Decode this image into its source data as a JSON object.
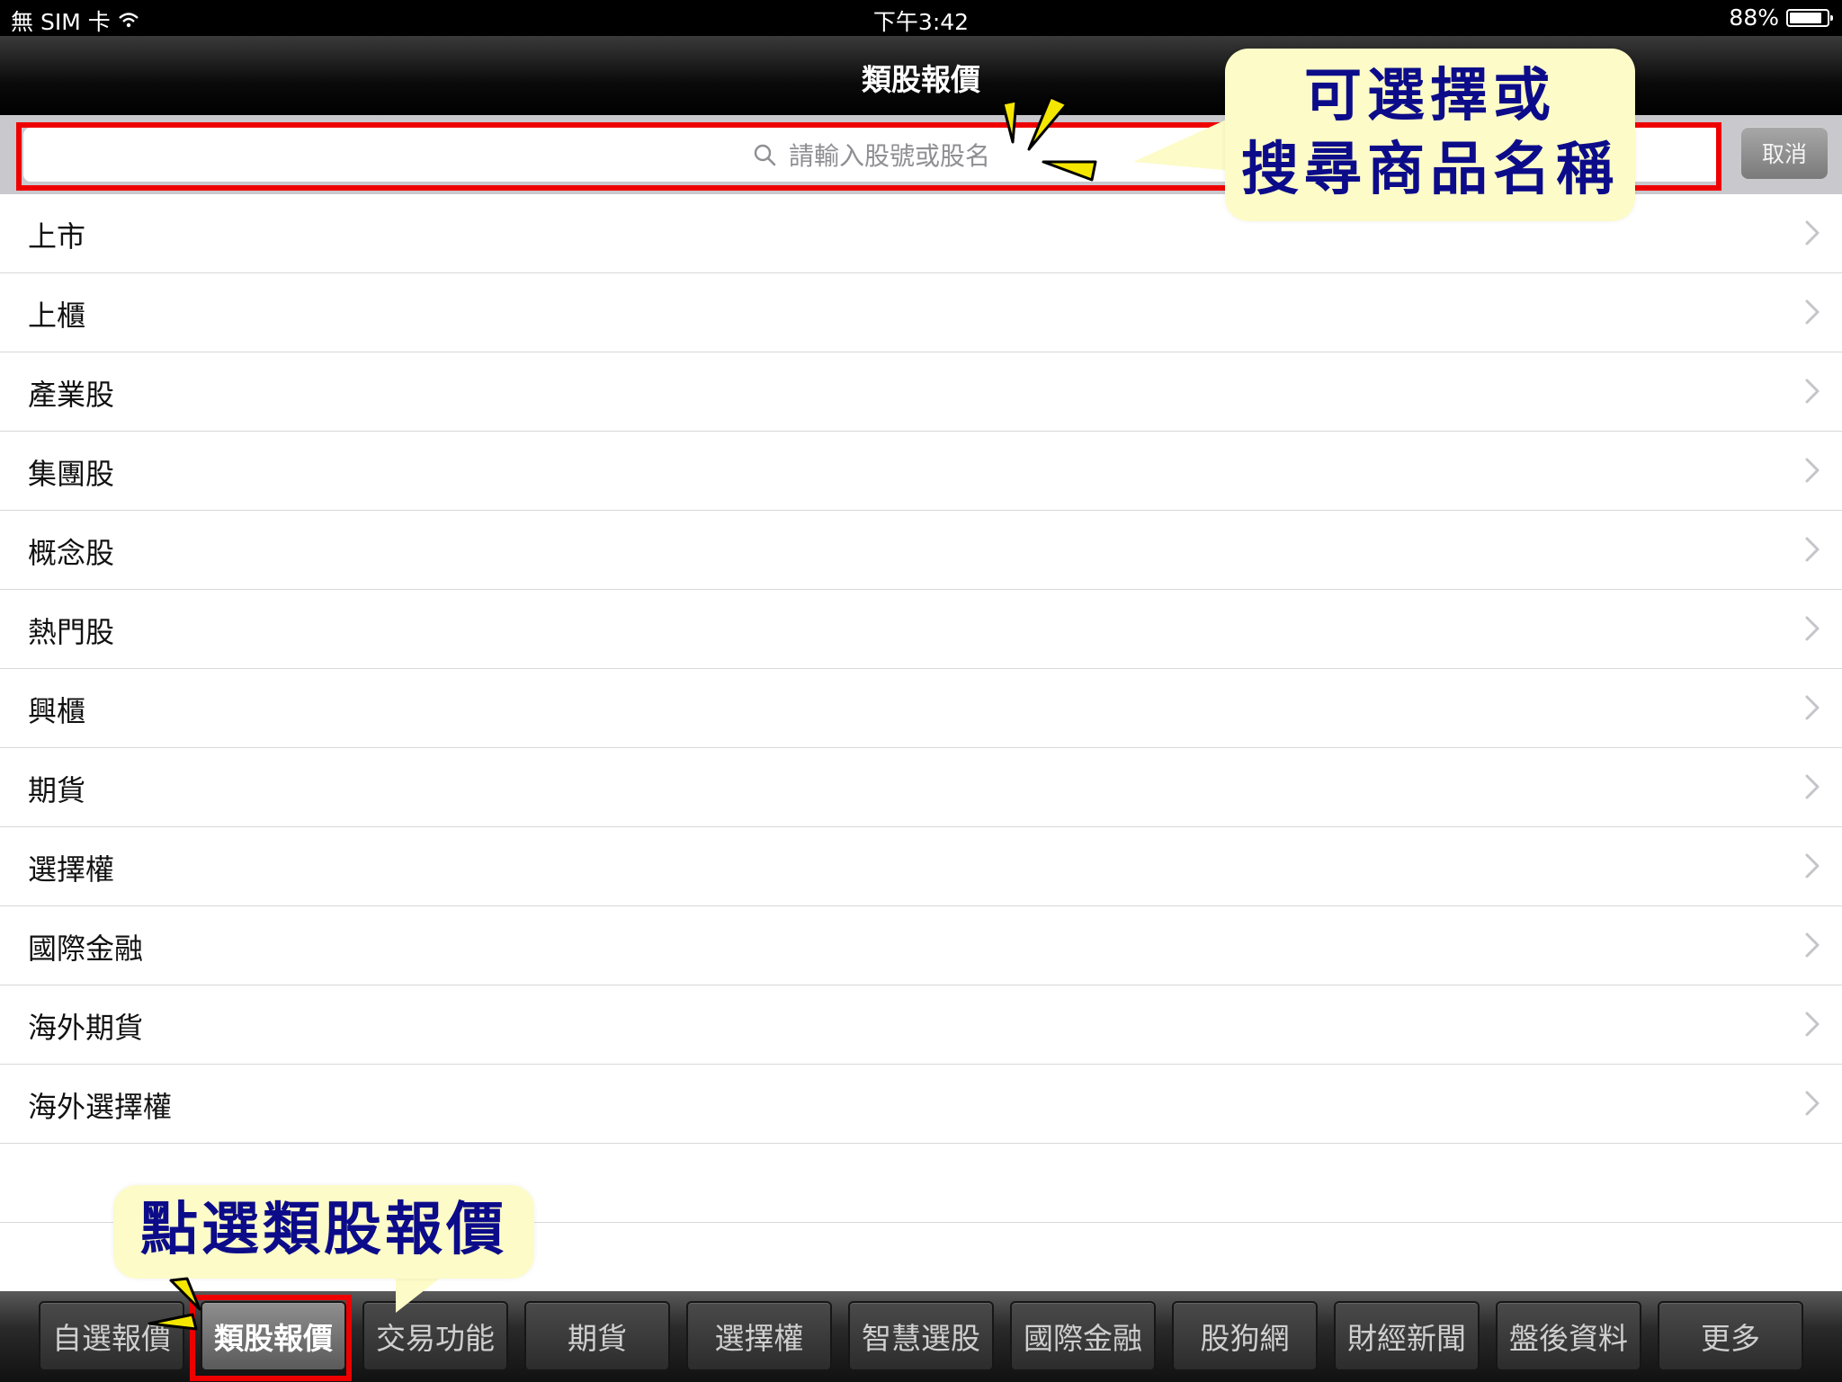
{
  "status_bar": {
    "carrier": "無 SIM 卡",
    "time": "下午3:42",
    "battery_text": "88%",
    "battery_level": 0.88
  },
  "nav": {
    "title": "類股報價"
  },
  "search": {
    "placeholder": "請輸入股號或股名",
    "cancel_label": "取消"
  },
  "list": {
    "items": [
      "上市",
      "上櫃",
      "產業股",
      "集團股",
      "概念股",
      "熱門股",
      "興櫃",
      "期貨",
      "選擇權",
      "國際金融",
      "海外期貨",
      "海外選擇權"
    ]
  },
  "tabbar": {
    "tabs": [
      "自選報價",
      "類股報價",
      "交易功能",
      "期貨",
      "選擇權",
      "智慧選股",
      "國際金融",
      "股狗網",
      "財經新聞",
      "盤後資料",
      "更多"
    ],
    "active_index": 1
  },
  "annotations": {
    "search_callout_line1": "可選擇或",
    "search_callout_line2": "搜尋商品名稱",
    "tab_callout": "點選類股報價"
  },
  "colors": {
    "highlight": "#ee0000",
    "callout_bg": "#fdfbc7",
    "callout_text": "#0c0c8a"
  }
}
